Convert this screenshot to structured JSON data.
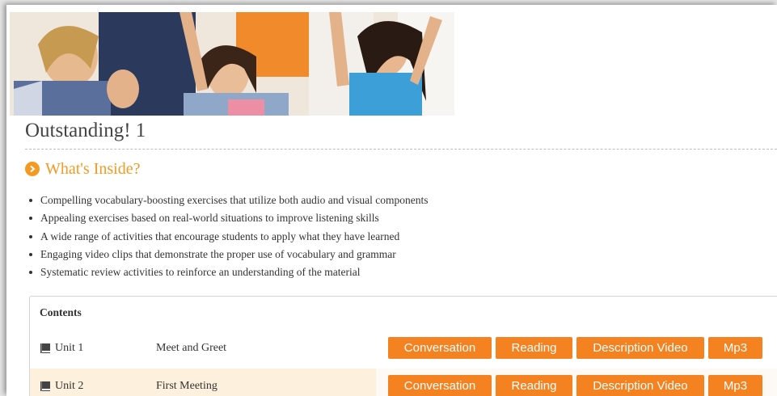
{
  "product": {
    "title": "Outstanding! 1"
  },
  "section": {
    "icon": "chevron-right-circle-icon",
    "title": "What's Inside?"
  },
  "features": [
    "Compelling vocabulary-boosting exercises that utilize both audio and visual components",
    "Appealing exercises based on real-world situations to improve listening skills",
    "A wide range of activities that encourage students to apply what they have learned",
    "Engaging video clips that demonstrate the proper use of vocabulary and grammar",
    "Systematic review activities to reinforce an understanding of the material"
  ],
  "contents": {
    "label": "Contents",
    "units": [
      {
        "icon": "book-icon",
        "name": "Unit 1",
        "topic": "Meet and Greet",
        "buttons": [
          "Conversation",
          "Reading",
          "Description Video",
          "Mp3"
        ]
      },
      {
        "icon": "book-icon",
        "name": "Unit 2",
        "topic": "First Meeting",
        "buttons": [
          "Conversation",
          "Reading",
          "Description Video",
          "Mp3"
        ]
      }
    ]
  },
  "colors": {
    "accent": "#f39a22",
    "button": "#f58220",
    "row_highlight": "#fdf0dc"
  }
}
